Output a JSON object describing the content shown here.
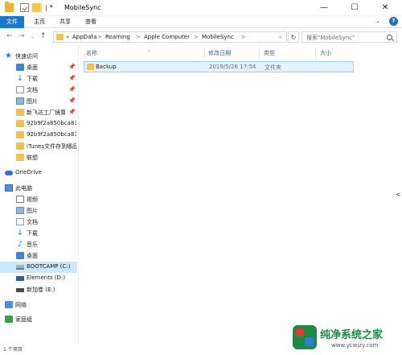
{
  "window": {
    "title": "MobileSync",
    "controls": {
      "minimize": "—",
      "maximize": "☐",
      "close": "✕"
    }
  },
  "quick_access_toolbar": {
    "separator": "|",
    "dropdown": "▾"
  },
  "ribbon": {
    "tabs": [
      "文件",
      "主页",
      "共享",
      "查看"
    ],
    "collapse": "⌄",
    "help": "?"
  },
  "address_bar": {
    "back": "←",
    "forward": "→",
    "recent": "⌄",
    "up": "↑",
    "overflow": "«",
    "crumbs": [
      "AppData",
      "Roaming",
      "Apple Computer",
      "MobileSync"
    ],
    "separator": ">",
    "dropdown": "⌄",
    "refresh": "↻",
    "search_placeholder": "搜索\"MobileSync\""
  },
  "nav_pane": {
    "quick_access": "快速访问",
    "pin": "📌",
    "pinned": [
      "桌面",
      "下载",
      "文档",
      "图片",
      "新飞达工厂镜算"
    ],
    "recent": [
      "92b9f2a850bca83",
      "92b9f2a850bca83",
      "iTunes文件存到哪品",
      "联想"
    ],
    "onedrive": "OneDrive",
    "this_pc": "此电脑",
    "pc_items": [
      "视频",
      "图片",
      "文档",
      "下载",
      "音乐",
      "桌面",
      "BOOTCAMP (C:)",
      "Elements (D:)",
      "新加卷 (E:)"
    ],
    "network": "网络",
    "homegroup": "家庭组"
  },
  "file_list": {
    "columns": [
      "名称",
      "修改日期",
      "类型",
      "大小"
    ],
    "sort_indicator": "^",
    "rows": [
      {
        "name": "Backup",
        "modified": "2019/5/26 17:54",
        "type": "文件夹",
        "size": ""
      }
    ]
  },
  "details_toggle": "<",
  "status_bar": {
    "item_count": "1 个项目"
  },
  "watermark": {
    "title": "纯净系统之家",
    "url": "www.ycwjzy.com"
  }
}
